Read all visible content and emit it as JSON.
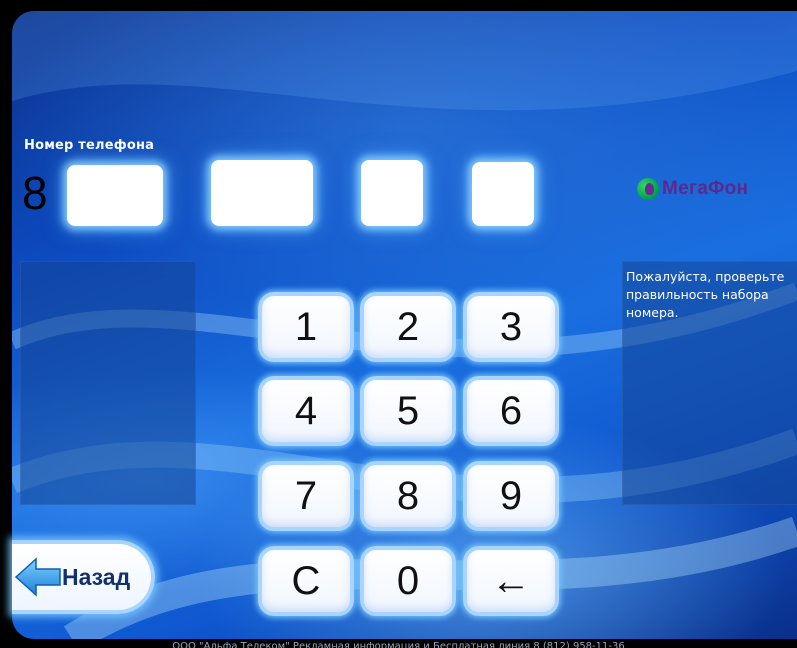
{
  "phone": {
    "label": "Номер телефона",
    "prefix": "8",
    "fields": [
      "",
      "",
      "",
      ""
    ]
  },
  "operator": {
    "name": "МегаФон",
    "icon": "megafon-logo-icon"
  },
  "info": {
    "message": "Пожалуйста, проверьте правильность набора номера."
  },
  "keypad": {
    "keys": [
      "1",
      "2",
      "3",
      "4",
      "5",
      "6",
      "7",
      "8",
      "9",
      "C",
      "0",
      "←"
    ]
  },
  "nav": {
    "back_label": "Назад",
    "back_icon": "arrow-left-icon"
  },
  "footer": {
    "text": "ООО \"Альфа Телеком\" Рекламная информация и Бесплатная линия 8 (812) 958-11-36"
  },
  "colors": {
    "accent_green": "#00a651",
    "brand_purple": "#5a2a8c",
    "key_border": "#a9d4ff"
  }
}
